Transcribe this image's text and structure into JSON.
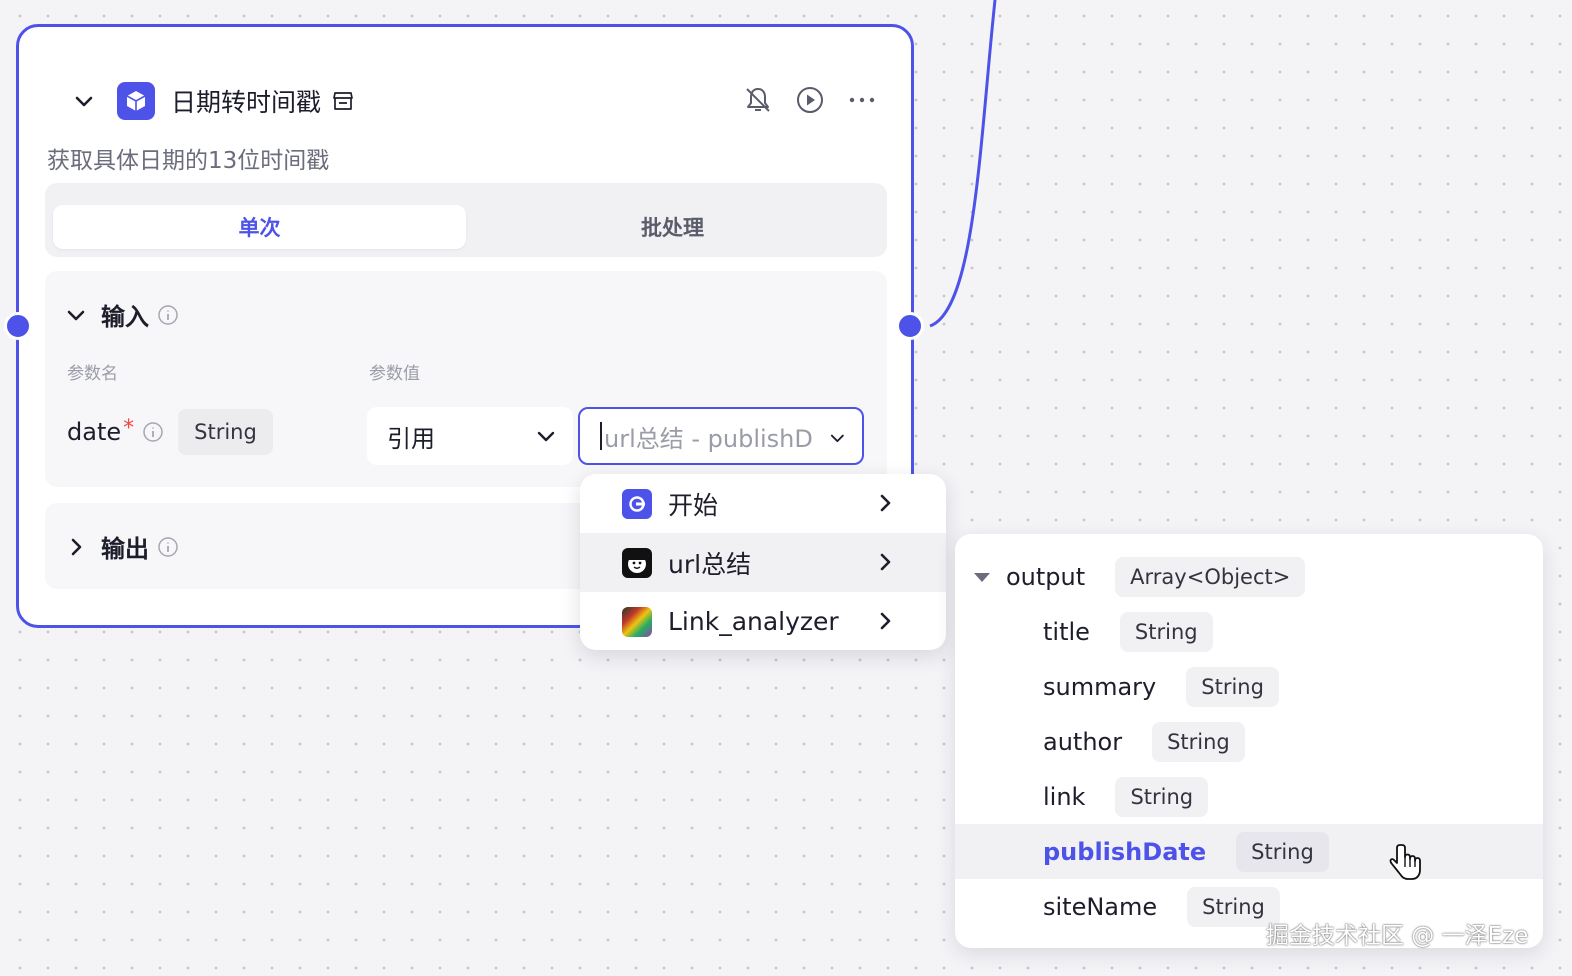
{
  "node": {
    "title": "日期转时间戳",
    "description": "获取具体日期的13位时间戳",
    "tabs": [
      "单次",
      "批处理"
    ],
    "active_tab": "单次",
    "accent_color": "#4d53e8",
    "input_section": {
      "title": "输入",
      "col_name_label": "参数名",
      "col_value_label": "参数值",
      "param": {
        "name": "date",
        "required_mark": "*",
        "type": "String",
        "ref_mode": "引用",
        "ref_value": "url总结 - publishD"
      }
    },
    "output_section": {
      "title": "输出"
    }
  },
  "menu": {
    "items": [
      {
        "label": "开始",
        "icon": "start-node-icon"
      },
      {
        "label": "url总结",
        "icon": "bot-face-icon"
      },
      {
        "label": "Link_analyzer",
        "icon": "colorful-plugin-icon"
      }
    ],
    "hovered_index": 1
  },
  "tree": {
    "root": {
      "label": "output",
      "type": "Array<Object>"
    },
    "children": [
      {
        "label": "title",
        "type": "String"
      },
      {
        "label": "summary",
        "type": "String"
      },
      {
        "label": "author",
        "type": "String"
      },
      {
        "label": "link",
        "type": "String"
      },
      {
        "label": "publishDate",
        "type": "String"
      },
      {
        "label": "siteName",
        "type": "String"
      }
    ],
    "selected_label": "publishDate"
  },
  "watermark": "掘金技术社区 @ 一泽Eze"
}
